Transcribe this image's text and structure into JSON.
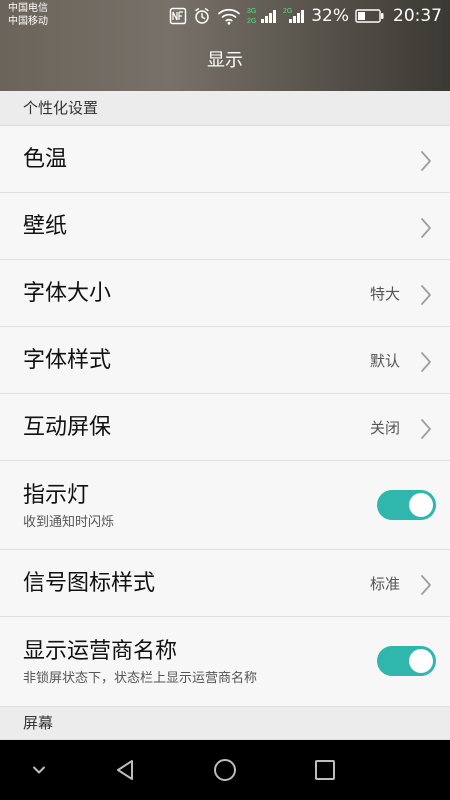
{
  "status_bar": {
    "carriers": [
      "中国电信",
      "中国移动"
    ],
    "network_top": "3G",
    "network_bottom": "2G",
    "network_secondary": "2G",
    "battery_percent": "32%",
    "time": "20:37"
  },
  "header": {
    "title": "显示"
  },
  "sections": {
    "personalization": {
      "title": "个性化设置"
    },
    "screen": {
      "title": "屏幕"
    }
  },
  "items": [
    {
      "title": "色温",
      "value": "",
      "control": "chevron"
    },
    {
      "title": "壁纸",
      "value": "",
      "control": "chevron"
    },
    {
      "title": "字体大小",
      "value": "特大",
      "control": "chevron"
    },
    {
      "title": "字体样式",
      "value": "默认",
      "control": "chevron"
    },
    {
      "title": "互动屏保",
      "value": "关闭",
      "control": "chevron"
    },
    {
      "title": "指示灯",
      "subtitle": "收到通知时闪烁",
      "control": "toggle",
      "state": "on"
    },
    {
      "title": "信号图标样式",
      "value": "标准",
      "control": "chevron"
    },
    {
      "title": "显示运营商名称",
      "subtitle": "非锁屏状态下，状态栏上显示运营商名称",
      "control": "toggle",
      "state": "on"
    }
  ],
  "theme": {
    "header_left": "#6a645b",
    "header_right": "#3b3933",
    "background": "#f5f5f5",
    "section_background": "#ececec",
    "toggle_on": "#2fb7ad",
    "nav_background": "#000000",
    "nav_icon": "#bdbdbd"
  },
  "icons": {
    "status": [
      "nfc-icon",
      "alarm-icon",
      "wifi-icon",
      "signal-icon",
      "battery-icon"
    ],
    "navigation": [
      "chevron-down-icon",
      "back-icon",
      "home-icon",
      "recent-apps-icon"
    ]
  }
}
